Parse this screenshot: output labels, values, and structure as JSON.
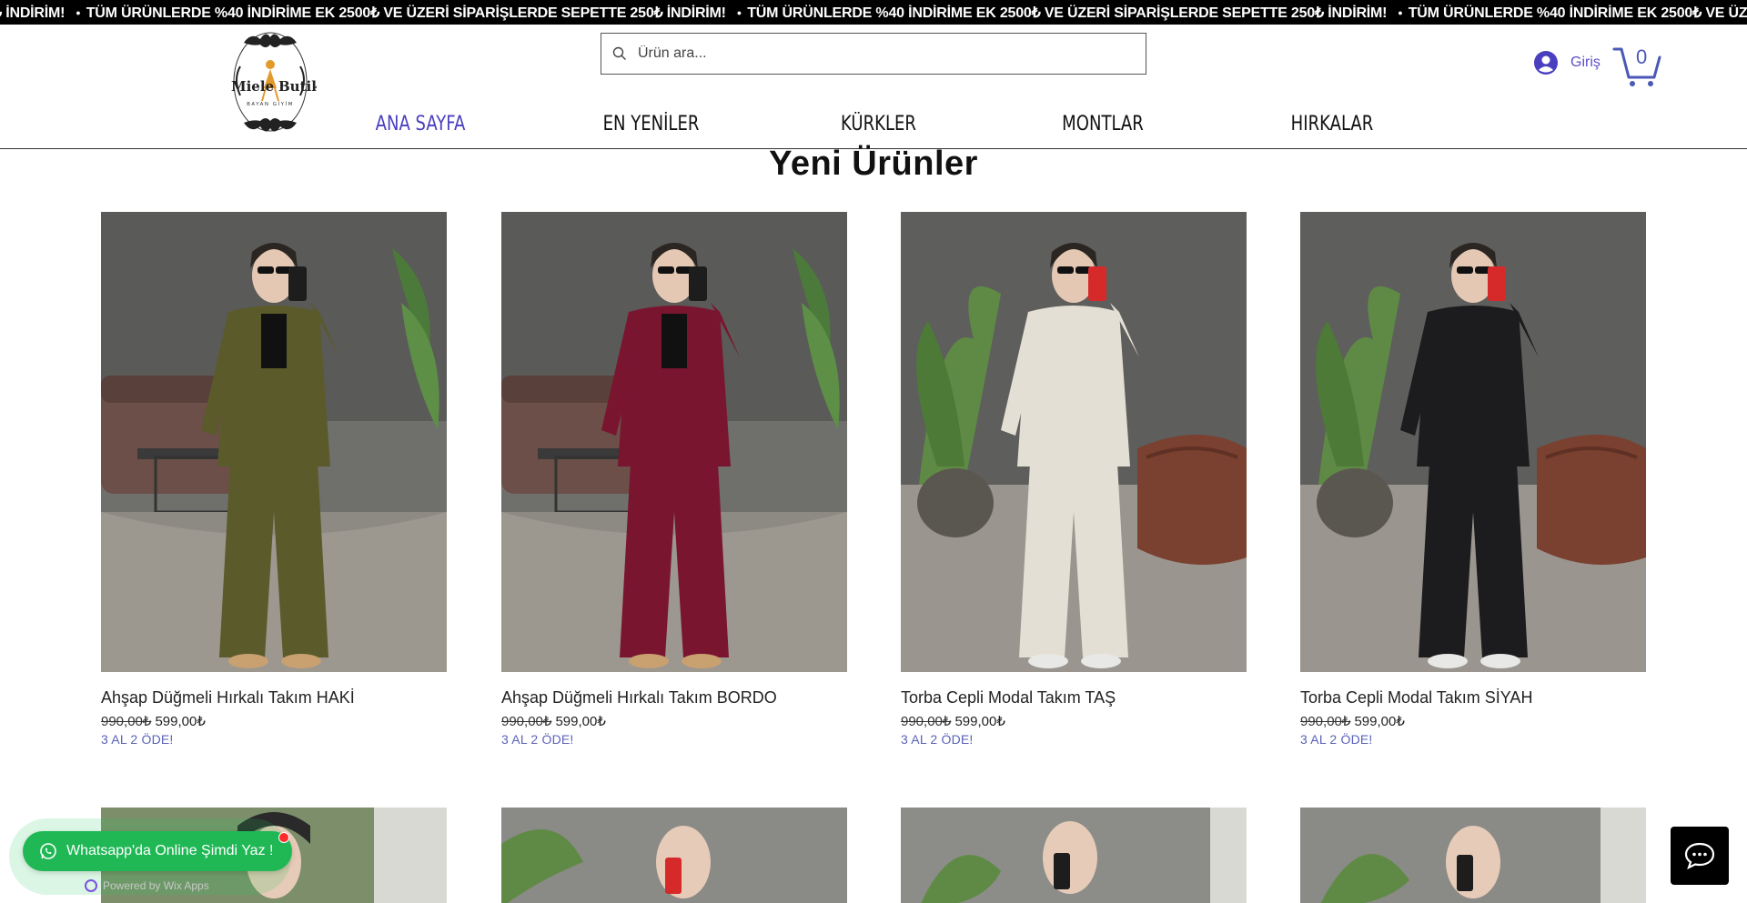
{
  "banner": {
    "segments": [
      "₺ İNDİRİM!",
      "TÜM ÜRÜNLERDE %40 İNDİRİME EK 2500₺ VE ÜZERİ SİPARİŞLERDE SEPETTE 250₺ İNDİRİM!",
      "TÜM ÜRÜNLERDE %40 İNDİRİME EK 2500₺ VE ÜZERİ SİPARİŞLERDE SEPETTE 250₺ İNDİRİM!",
      "TÜM ÜRÜNLERDE %40 İNDİRİME EK 2500₺ VE ÜZERİ SİPARİŞLERDE SEPETTE 2"
    ],
    "separator": "●"
  },
  "header": {
    "logo": {
      "line1a": "Miele",
      "line1b": "Butik",
      "line2": "BAYAN GİYİM"
    },
    "search_placeholder": "Ürün ara...",
    "login_label": "Giriş",
    "cart_count": "0"
  },
  "nav": {
    "items": [
      {
        "label": "ANA SAYFA",
        "active": true
      },
      {
        "label": "EN YENİLER",
        "active": false
      },
      {
        "label": "KÜRKLER",
        "active": false
      },
      {
        "label": "MONTLAR",
        "active": false
      },
      {
        "label": "HIRKALAR",
        "active": false
      }
    ]
  },
  "section": {
    "title": "Yeni Ürünler"
  },
  "products": [
    {
      "name": "Ahşap Düğmeli Hırkalı Takım HAKİ",
      "old_price": "990,00₺",
      "price": "599,00₺",
      "ribbon": "3 AL 2 ÖDE!",
      "outfit_color": "#5b5a2a",
      "scene": "sofa"
    },
    {
      "name": "Ahşap Düğmeli Hırkalı Takım BORDO",
      "old_price": "990,00₺",
      "price": "599,00₺",
      "ribbon": "3 AL 2 ÖDE!",
      "outfit_color": "#7a1530",
      "scene": "sofa"
    },
    {
      "name": "Torba Cepli Modal Takım TAŞ",
      "old_price": "990,00₺",
      "price": "599,00₺",
      "ribbon": "3 AL 2 ÖDE!",
      "outfit_color": "#e4dfd4",
      "scene": "plant"
    },
    {
      "name": "Torba Cepli Modal Takım SİYAH",
      "old_price": "990,00₺",
      "price": "599,00₺",
      "ribbon": "3 AL 2 ÖDE!",
      "outfit_color": "#1c1c1e",
      "scene": "plant"
    }
  ],
  "whatsapp": {
    "label": "Whatsapp'da Online Şimdi Yaz !",
    "powered": "Powered by Wix Apps"
  },
  "colors": {
    "accent": "#4a3fbf",
    "whatsapp": "#1fb855",
    "ribbon": "#5a62b8"
  }
}
